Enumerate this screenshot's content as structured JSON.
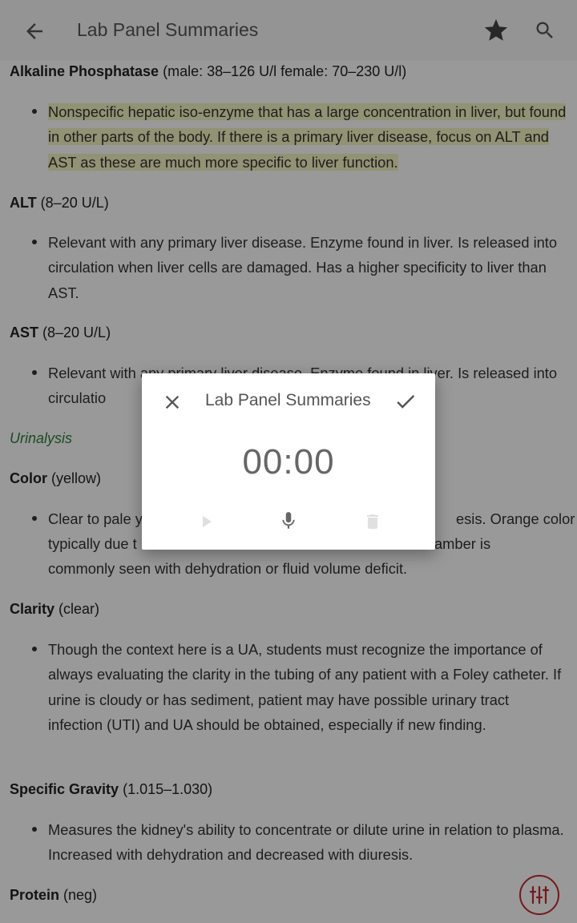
{
  "appbar": {
    "title": "Lab Panel Summaries",
    "icons": [
      "back-arrow-icon",
      "star-icon",
      "search-icon"
    ]
  },
  "content": {
    "alk_phos": {
      "name": "Alkaline Phosphatase",
      "range": "(male: 38–126 U/l female: 70–230 U/l)",
      "bullet": "Nonspecific hepatic iso-enzyme that has a large concentration in liver, but found in other parts of the body. If there is a primary liver disease, focus on ALT and AST as these are much more specific to liver function."
    },
    "alt": {
      "name": "ALT",
      "range": "(8–20 U/L)",
      "bullet": "Relevant with any primary liver disease. Enzyme found in liver. Is released into circulation when liver cells are damaged. Has a higher specificity to liver than AST."
    },
    "ast": {
      "name": "AST",
      "range": "(8–20 U/L)",
      "bullet": "Relevant with any primary liver disease. Enzyme found in liver. Is released into circulatio"
    },
    "urinalysis": "Urinalysis",
    "color": {
      "name": "Color",
      "range": "(yellow)",
      "bullet_line1a": "Clear to pale y",
      "bullet_line1b": "esis. Orange color",
      "bullet_line2a": "typically due t",
      "bullet_line2b": "amber is",
      "bullet_line3": "commonly seen with dehydration or fluid volume deficit."
    },
    "clarity": {
      "name": "Clarity",
      "range": "(clear)",
      "bullet": "Though the context here is a UA, students must recognize the importance of always evaluating the clarity in the tubing of any patient with a Foley catheter. If urine is cloudy or has sediment, patient may have possible urinary tract infection (UTI) and UA should be obtained, especially if new finding."
    },
    "specific_gravity": {
      "name": "Specific Gravity",
      "range": "(1.015–1.030)",
      "bullet": "Measures the kidney's ability to concentrate or dilute urine in relation to plasma. Increased with dehydration and decreased with diuresis."
    },
    "protein": {
      "name": "Protein",
      "range": "(neg)"
    }
  },
  "dialog": {
    "title": "Lab Panel Summaries",
    "timer": "00:00",
    "icons": [
      "close-icon",
      "check-icon",
      "play-icon",
      "mic-icon",
      "trash-icon"
    ]
  },
  "fab": {
    "icon": "sliders-icon",
    "color": "#c62828"
  },
  "colors": {
    "highlight": "#f4f3c2",
    "urinalysis": "#2e7d32"
  }
}
